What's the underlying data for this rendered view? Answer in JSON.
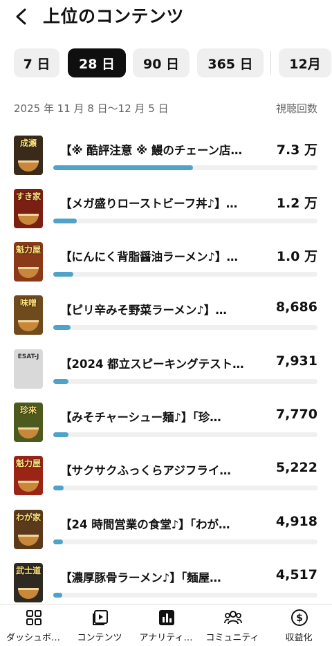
{
  "header": {
    "title": "上位のコンテンツ",
    "back_icon": "chevron-left-icon"
  },
  "chips": [
    {
      "label": "7 日",
      "active": false
    },
    {
      "label": "28 日",
      "active": true
    },
    {
      "label": "90 日",
      "active": false
    },
    {
      "label": "365 日",
      "active": false
    },
    {
      "label": "12月",
      "active": false
    }
  ],
  "date_range": "2025 年 11 月 8 日〜12 月 5 日",
  "metric_label": "視聴回数",
  "bar_color": "#4fa3c9",
  "items": [
    {
      "title": "【※ 酷評注意 ※ 鰻のチェーン店…",
      "views": "7.3 万",
      "share": 0.53,
      "thumb_text": "成瀬",
      "thumb_bg": "#3a2a1a"
    },
    {
      "title": "【メガ盛りローストビーフ丼♪】…",
      "views": "1.2 万",
      "share": 0.09,
      "thumb_text": "すき家",
      "thumb_bg": "#7a1f12"
    },
    {
      "title": "【にんにく背脂醤油ラーメン♪】…",
      "views": "1.0 万",
      "share": 0.075,
      "thumb_text": "魁力屋",
      "thumb_bg": "#8a3a18"
    },
    {
      "title": "【ピリ辛みそ野菜ラーメン♪】…",
      "views": "8,686",
      "share": 0.065,
      "thumb_text": "味噌",
      "thumb_bg": "#6e4a1c"
    },
    {
      "title": "【2024 都立スピーキングテスト…",
      "views": "7,931",
      "share": 0.058,
      "thumb_text": "ESAT-J",
      "thumb_bg": "#d9d9d9"
    },
    {
      "title": "【みそチャーシュー麺♪】「珍…",
      "views": "7,770",
      "share": 0.057,
      "thumb_text": "珍來",
      "thumb_bg": "#4d5a1e"
    },
    {
      "title": "【サクサクふっくらアジフライ…",
      "views": "5,222",
      "share": 0.04,
      "thumb_text": "魁力屋",
      "thumb_bg": "#9a2416"
    },
    {
      "title": "【24 時間営業の食堂♪】「わが…",
      "views": "4,918",
      "share": 0.037,
      "thumb_text": "わが家",
      "thumb_bg": "#5a3a1a"
    },
    {
      "title": "【濃厚豚骨ラーメン♪】「麺屋…",
      "views": "4,517",
      "share": 0.034,
      "thumb_text": "武士道",
      "thumb_bg": "#2e2a22"
    }
  ],
  "bottom_nav": [
    {
      "label": "ダッシュボ…",
      "icon": "dashboard-icon"
    },
    {
      "label": "コンテンツ",
      "icon": "content-icon"
    },
    {
      "label": "アナリティ…",
      "icon": "analytics-icon"
    },
    {
      "label": "コミュニティ",
      "icon": "community-icon"
    },
    {
      "label": "収益化",
      "icon": "monetization-icon"
    }
  ]
}
